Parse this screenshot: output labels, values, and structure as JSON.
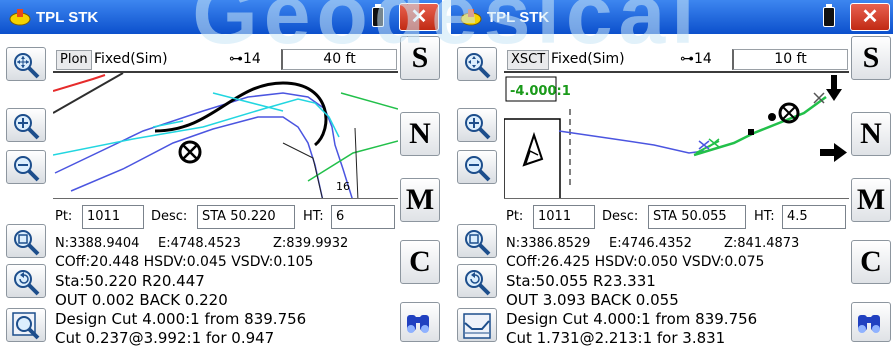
{
  "watermark": "Geodesical",
  "panels": [
    {
      "title": "TPL STK",
      "status": {
        "mode": "Plon",
        "fix": "Fixed(Sim)",
        "satellites": "14",
        "scale": "40 ft"
      },
      "map": {
        "label_16": "16"
      },
      "fields": {
        "pt_label": "Pt:",
        "pt_value": "1011",
        "desc_label": "Desc:",
        "desc_value": "STA 50.220",
        "ht_label": "HT:",
        "ht_value": "6"
      },
      "info": {
        "n": "N:3388.9404",
        "e": "E:4748.4523",
        "z": "Z:839.9932",
        "line1": "COff:20.448 HSDV:0.045 VSDV:0.105",
        "line2": "Sta:50.220 R20.447",
        "line3": "OUT 0.002 BACK 0.220",
        "line4": "Design Cut 4.000:1 from 839.756",
        "line5": "Cut 0.237@3.992:1 for 0.947"
      },
      "buttons": {
        "s": "S",
        "n": "N",
        "m": "M",
        "c": "C"
      }
    },
    {
      "title": "TPL STK",
      "status": {
        "mode": "XSCT",
        "fix": "Fixed(Sim)",
        "satellites": "14",
        "scale": "10 ft"
      },
      "map": {
        "slope_label": "-4.000:1"
      },
      "fields": {
        "pt_label": "Pt:",
        "pt_value": "1011",
        "desc_label": "Desc:",
        "desc_value": "STA 50.055",
        "ht_label": "HT:",
        "ht_value": "4.5"
      },
      "info": {
        "n": "N:3386.8529",
        "e": "E:4746.4352",
        "z": "Z:841.4873",
        "line1": "COff:26.425 HSDV:0.050 VSDV:0.075",
        "line2": "Sta:50.055 R23.331",
        "line3": "OUT 3.093 BACK 0.055",
        "line4": "Design Cut 4.000:1 from 839.756",
        "line5": "Cut 1.731@2.213:1 for 3.831"
      },
      "buttons": {
        "s": "S",
        "n": "N",
        "m": "M",
        "c": "C"
      }
    }
  ],
  "colors": {
    "titlebar": "#1a5fd8",
    "close": "#d0331c",
    "slope_label": "#1a9a1a"
  }
}
